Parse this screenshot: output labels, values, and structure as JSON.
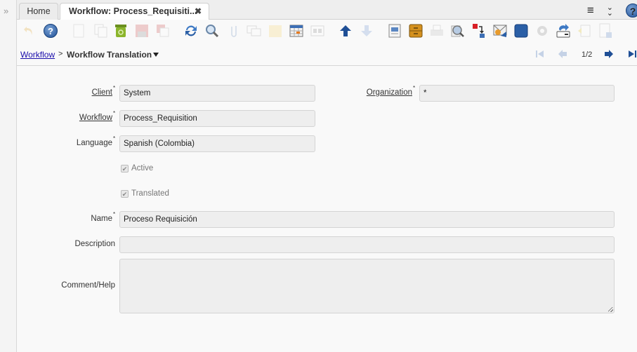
{
  "tabs": [
    {
      "label": "Home",
      "active": false
    },
    {
      "label": "Workflow: Process_Requisiti...",
      "active": true,
      "closable": true
    }
  ],
  "tab_tools": {
    "menu_icon": "hamburger-icon",
    "collapse_icon": "double-chevron-down-icon",
    "help_icon": "help-icon"
  },
  "toolbar": {
    "buttons": [
      {
        "name": "undo-icon",
        "enabled": false
      },
      {
        "name": "help-icon",
        "enabled": true
      },
      {
        "name": "new-record-icon",
        "enabled": false
      },
      {
        "name": "copy-record-icon",
        "enabled": false
      },
      {
        "name": "delete-icon",
        "enabled": true
      },
      {
        "name": "save-icon",
        "enabled": false
      },
      {
        "name": "save-and-new-icon",
        "enabled": false
      },
      {
        "name": "refresh-icon",
        "enabled": true
      },
      {
        "name": "find-icon",
        "enabled": true
      },
      {
        "name": "attachment-icon",
        "enabled": false
      },
      {
        "name": "chat-icon",
        "enabled": false
      },
      {
        "name": "postit-icon",
        "enabled": false
      },
      {
        "name": "grid-toggle-icon",
        "enabled": true
      },
      {
        "name": "multi-view-icon",
        "enabled": false
      },
      {
        "name": "parent-record-icon",
        "enabled": true
      },
      {
        "name": "detail-record-icon",
        "enabled": false
      },
      {
        "name": "report-icon",
        "enabled": true
      },
      {
        "name": "archive-icon",
        "enabled": true
      },
      {
        "name": "print-icon",
        "enabled": false
      },
      {
        "name": "zoom-across-icon",
        "enabled": true
      },
      {
        "name": "active-workflows-icon",
        "enabled": true
      },
      {
        "name": "request-icon",
        "enabled": true
      },
      {
        "name": "product-info-icon",
        "enabled": true
      },
      {
        "name": "process-icon",
        "enabled": false
      },
      {
        "name": "export-icon",
        "enabled": true
      },
      {
        "name": "import-icon",
        "enabled": false
      },
      {
        "name": "quick-form-icon",
        "enabled": false
      }
    ]
  },
  "breadcrumb": {
    "parent": "Workflow",
    "separator": ">",
    "current": "Workflow Translation"
  },
  "navigation": {
    "record_position": "1/2",
    "first_enabled": false,
    "previous_enabled": false,
    "next_enabled": true,
    "last_enabled": true
  },
  "form": {
    "client": {
      "label": "Client",
      "value": "System",
      "required": true
    },
    "organization": {
      "label": "Organization",
      "value": "*",
      "required": true
    },
    "workflow": {
      "label": "Workflow",
      "value": "Process_Requisition",
      "required": true
    },
    "language": {
      "label": "Language",
      "value": "Spanish (Colombia)",
      "required": true
    },
    "active": {
      "label": "Active",
      "checked": true
    },
    "translated": {
      "label": "Translated",
      "checked": true
    },
    "name": {
      "label": "Name",
      "value": "Proceso Requisición",
      "required": true
    },
    "description": {
      "label": "Description",
      "value": ""
    },
    "comment_help": {
      "label": "Comment/Help",
      "value": ""
    }
  },
  "symbols": {
    "expand": "»",
    "close": "✖",
    "menu": "≡",
    "collapse": "⌄",
    "help": "?",
    "check": "✔",
    "required": "*",
    "first": "⏮",
    "prev": "←",
    "next": "→",
    "last": "⏭"
  }
}
